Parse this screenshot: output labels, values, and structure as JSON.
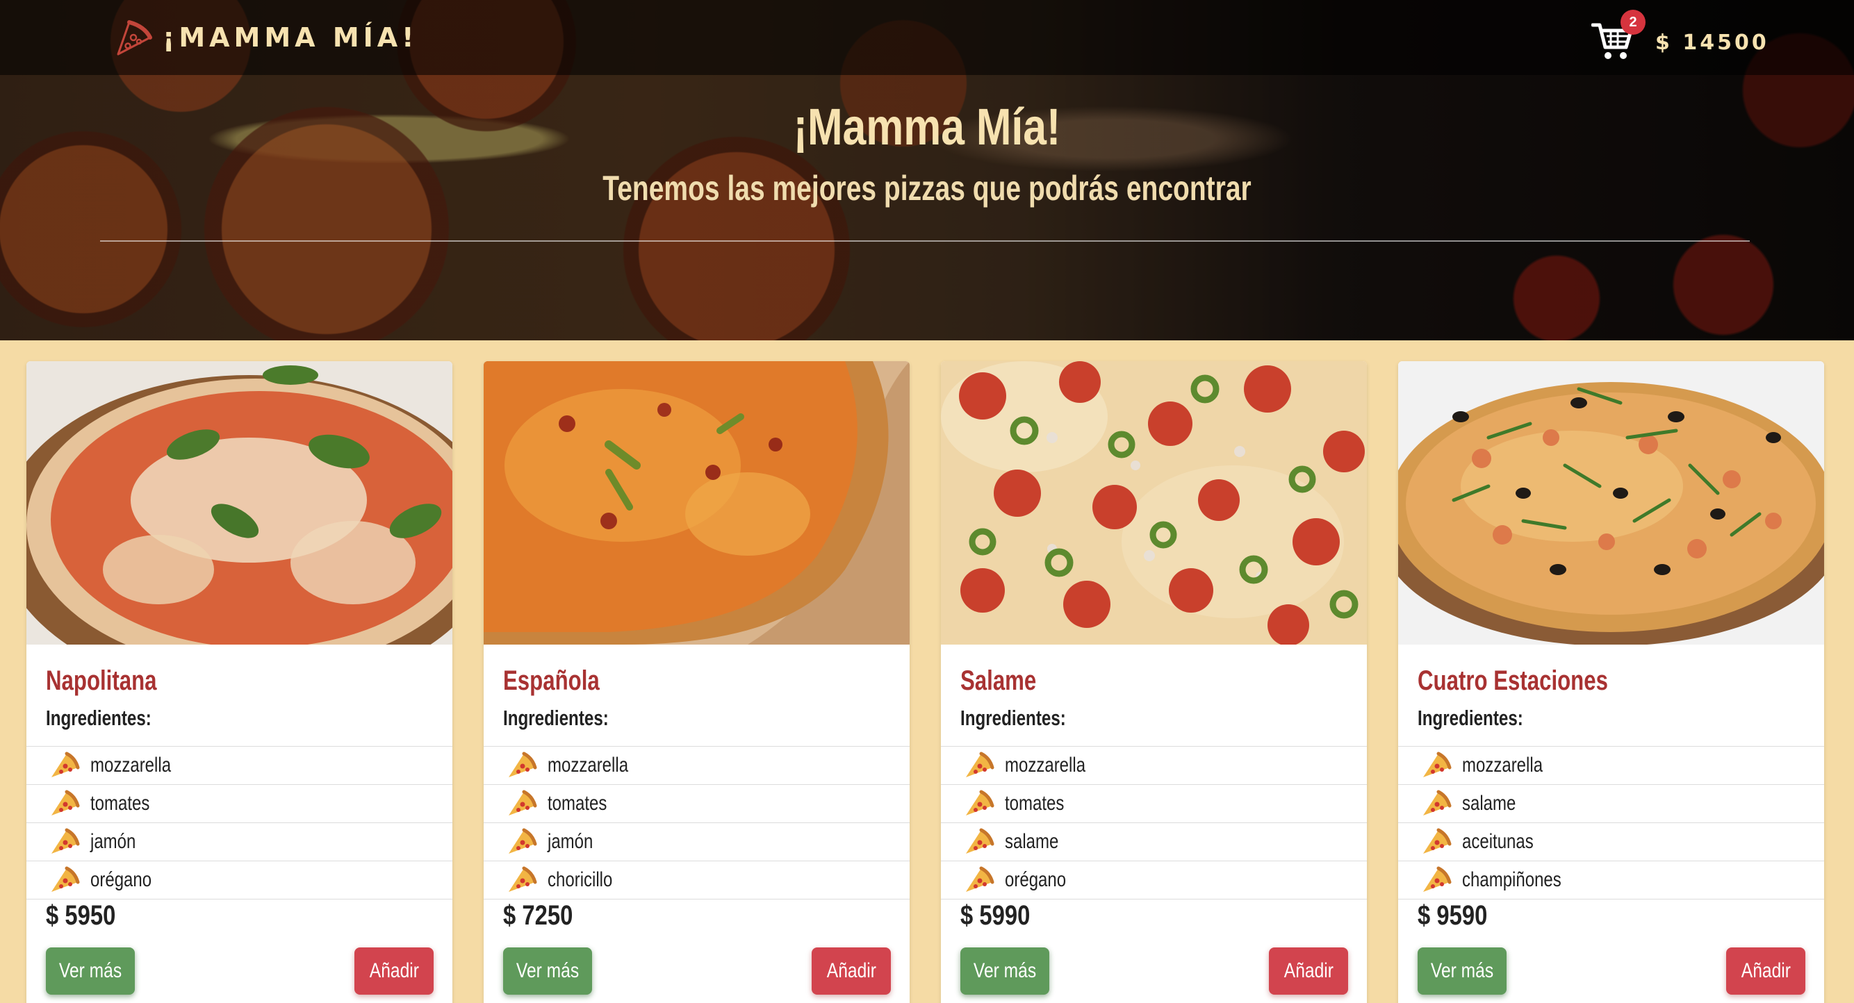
{
  "navbar": {
    "logo_text": "¡MAMMA MÍA!",
    "logo_icon": "pizza-slice-icon",
    "cart_icon": "shopping-cart-icon",
    "cart_count": "2",
    "cart_total": "$ 14500"
  },
  "hero": {
    "title": "¡Mamma Mía!",
    "subtitle": "Tenemos las mejores pizzas que podrás encontrar"
  },
  "ingredients_label": "Ingredientes:",
  "pizzas": [
    {
      "name": "Napolitana",
      "ingredients": [
        "mozzarella",
        "tomates",
        "jamón",
        "orégano"
      ],
      "price": "$ 5950",
      "more_label": "Ver más",
      "add_label": "Añadir"
    },
    {
      "name": "Española",
      "ingredients": [
        "mozzarella",
        "tomates",
        "jamón",
        "choricillo"
      ],
      "price": "$ 7250",
      "more_label": "Ver más",
      "add_label": "Añadir"
    },
    {
      "name": "Salame",
      "ingredients": [
        "mozzarella",
        "tomates",
        "salame",
        "orégano"
      ],
      "price": "$ 5990",
      "more_label": "Ver más",
      "add_label": "Añadir"
    },
    {
      "name": "Cuatro Estaciones",
      "ingredients": [
        "mozzarella",
        "salame",
        "aceitunas",
        "champiñones"
      ],
      "price": "$ 9590",
      "more_label": "Ver más",
      "add_label": "Añadir"
    }
  ],
  "colors": {
    "page_background": "#f5dba5",
    "accent_title": "#a83232",
    "button_more": "#5f9a5b",
    "button_add": "#d2444e",
    "badge": "#d6343e",
    "hero_text": "#f7e2b0"
  }
}
